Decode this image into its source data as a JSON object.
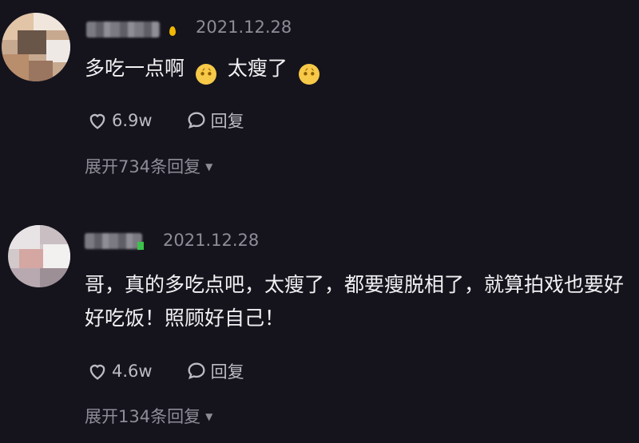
{
  "comments": [
    {
      "date": "2021.12.28",
      "text": "多吃一点啊",
      "text_tail": "太瘦了",
      "emoji_icon": "pleading-face",
      "likes": "6.9w",
      "reply_label": "回复",
      "expand_label": "展开734条回复"
    },
    {
      "date": "2021.12.28",
      "text": "哥，真的多吃点吧，太瘦了，都要瘦脱相了，就算拍戏也要好好吃饭！照顾好自己！",
      "likes": "4.6w",
      "reply_label": "回复",
      "expand_label": "展开134条回复"
    }
  ],
  "colors": {
    "background": "#15141d",
    "text": "#f2f2f4",
    "muted": "#8e8d97"
  }
}
